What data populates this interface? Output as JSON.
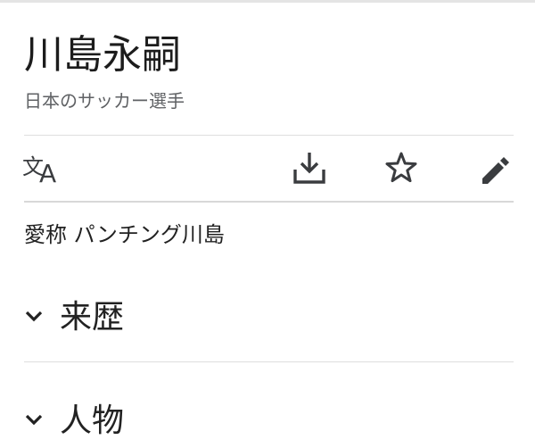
{
  "article": {
    "title": "川島永嗣",
    "subtitle": "日本のサッカー選手"
  },
  "toolbar": {
    "icons": [
      "language-translate-icon",
      "download-icon",
      "star-icon",
      "edit-pencil-icon"
    ]
  },
  "nickname": {
    "text": "愛称 パンチング川島"
  },
  "sections": [
    {
      "label": "来歴",
      "state": "collapsed"
    },
    {
      "label": "人物",
      "state": "collapsed"
    }
  ],
  "colors": {
    "text": "#222222",
    "subtitle": "#5f6164",
    "icon": "#3a3c3f",
    "divider": "#d8d8d8",
    "background": "#ffffff"
  }
}
